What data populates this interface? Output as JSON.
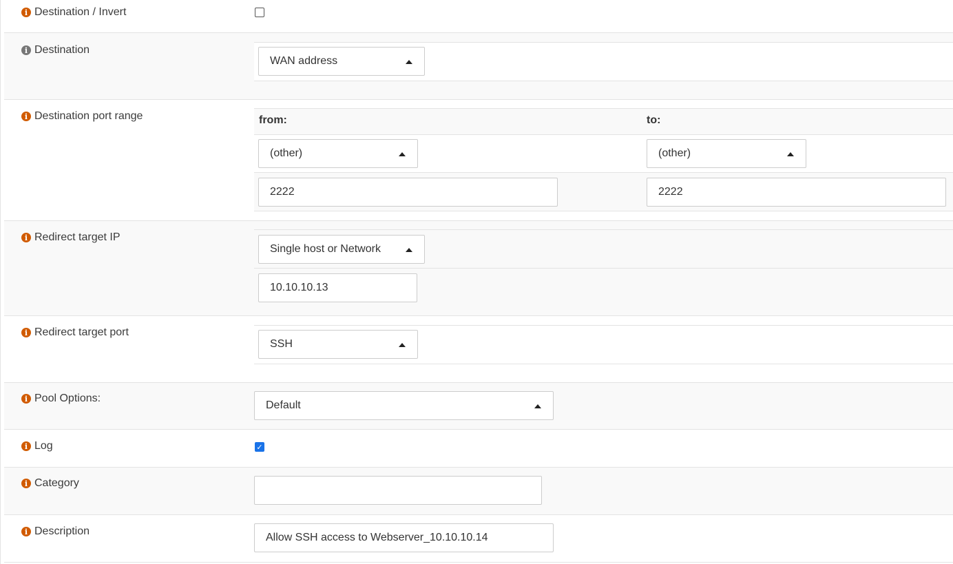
{
  "rows": {
    "destination_invert": {
      "label": "Destination / Invert",
      "checked": false
    },
    "destination": {
      "label": "Destination",
      "select": "WAN address"
    },
    "destination_port_range": {
      "label": "Destination port range",
      "from_header": "from:",
      "to_header": "to:",
      "from_select": "(other)",
      "to_select": "(other)",
      "from_value": "2222",
      "to_value": "2222"
    },
    "redirect_target_ip": {
      "label": "Redirect target IP",
      "select": "Single host or Network",
      "value": "10.10.10.13"
    },
    "redirect_target_port": {
      "label": "Redirect target port",
      "select": "SSH"
    },
    "pool_options": {
      "label": "Pool Options:",
      "select": "Default"
    },
    "log": {
      "label": "Log",
      "checked": true
    },
    "category": {
      "label": "Category",
      "value": ""
    },
    "description": {
      "label": "Description",
      "value": "Allow SSH access to Webserver_10.10.10.14"
    }
  },
  "icons": {
    "info": "info-circle-icon"
  },
  "colors": {
    "info_icon": "#d15b00",
    "info_icon_muted": "#777777",
    "checkbox_checked": "#1a73e8"
  }
}
